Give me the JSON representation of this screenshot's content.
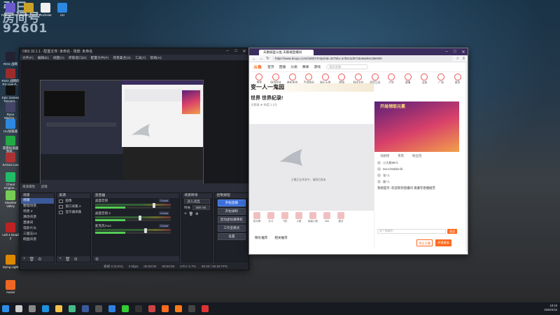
{
  "desktop": {
    "wallpaper_text": "引日\n房间号\n92601",
    "icons": [
      {
        "label": "Robust PEERSITE",
        "color": "#6a5acd"
      },
      {
        "label": "Tencent GTA V",
        "color": "#c9a227"
      },
      {
        "label": "Rockstar",
        "color": "#f0f0f0"
      },
      {
        "label": "UU",
        "color": "#2e88e0"
      },
      {
        "label": "RGS 战网",
        "color": "#223"
      },
      {
        "label": "ROG 战网的\nRX Live P...",
        "color": "#9c2c2c"
      },
      {
        "label": "Epic Games\nTencent...",
        "color": "#111"
      },
      {
        "label": "Ryou\nWarrior...",
        "color": "#446"
      },
      {
        "label": "UU加速器",
        "color": "#2e88e0"
      },
      {
        "label": "雷霆加速器\n游戏...",
        "color": "#2a4"
      },
      {
        "label": "SAN14 Leo",
        "color": "#a33"
      },
      {
        "label": "Cheat\nEngine...",
        "color": "#2b6"
      },
      {
        "label": "Stardew\nValley",
        "color": "#7c5"
      },
      {
        "label": "Left 4 Dead\n2",
        "color": "#b22"
      },
      {
        "label": "Dying Light",
        "color": "#d80"
      },
      {
        "label": "Assist",
        "color": "#e62"
      }
    ]
  },
  "obs": {
    "title": "OBS 32.1.1 - 配置文件: 未命名 - 场景: 未命名",
    "menu": [
      "文件(F)",
      "编辑(E)",
      "视图(V)",
      "停靠窗口(D)",
      "配置文件(P)",
      "场景集合(S)",
      "工具(T)",
      "帮助(H)"
    ],
    "tabs": [
      "来源属性",
      "滤镜"
    ],
    "scenes": {
      "header": "场景",
      "items": [
        "场景",
        "整理场景",
        "场景 2",
        "满场背景",
        "直播间",
        "电影片头",
        "三国志14",
        "韩国背景"
      ],
      "selected": 0
    },
    "sources": {
      "header": "来源",
      "items": [
        "图像",
        "窗口采集 2",
        "显示器采集"
      ]
    },
    "mixer": {
      "header": "混音器",
      "tracks": [
        {
          "name": "桌面音频",
          "db": "Global",
          "level": 0.82
        },
        {
          "name": "桌面音频 2",
          "db": "Global",
          "level": 0.62
        },
        {
          "name": "麦克风/Aux",
          "db": "Global",
          "level": 0.7
        }
      ]
    },
    "transitions": {
      "header": "场景转场",
      "type": "淡入淡出",
      "duration_label": "时长",
      "duration": "300 ms"
    },
    "controls": {
      "header": "控制按钮",
      "buttons": [
        "开始直播",
        "开始录制",
        "启动虚拟摄像机",
        "工作室模式",
        "设置"
      ]
    },
    "status": {
      "frames": "丢帧 0 (0.0%)",
      "bitrate": "0 kbps",
      "live_time": "00:00:00",
      "rec_time": "00:00:00",
      "cpu": "CPU: 0.7%",
      "fps": "60.00 / 60.00 FPS"
    },
    "preview_hint": "正在加载..."
  },
  "browser": {
    "tab_title": "天鹅城里斗鱼 天鹅城直播间",
    "url": "https://www.douyu.com/328074?dyshid=3275b1-a7b0c2d07c8e8a094c38e000",
    "site": {
      "logo": "斗鱼",
      "nav": [
        "首页",
        "直播",
        "分类",
        "赛事",
        "游戏"
      ],
      "search_placeholder": "搜索直播",
      "categories": [
        "推荐",
        "网游竞技",
        "单机热游",
        "手游休闲",
        "娱乐天地",
        "颜值",
        "科技文化",
        "语音互动",
        "户外",
        "赛事",
        "全部",
        "广场",
        "更多"
      ]
    },
    "room": {
      "banner": "变一人一鬼园",
      "title": "世界 世界纪录!",
      "subtitle": "天鹅城 ★ 热度 1.2万",
      "player_text": "主播正在休息中，请稍后再来"
    },
    "gifts": [
      "荧光棒",
      "办卡",
      "飞机",
      "火箭",
      "超级火箭",
      "666",
      "魔法"
    ],
    "below_gifts": [
      "精彩推荐",
      "相关推荐"
    ],
    "side": {
      "ad_title": "开局领取元素",
      "tabs": [
        "贡献榜",
        "贵宾",
        "粉丝团"
      ],
      "ranks": [
        "小天鹅8871",
        "Dunc/Wabkinfd",
        "张*人",
        "路*人"
      ],
      "chat": "系统提示: 欢迎来到直播间 请遵守直播规范",
      "send_placeholder": "发个弹幕吧~",
      "send_label": "发送"
    },
    "buttons": {
      "follow": "关注主播",
      "subscribe": "开通贵族"
    }
  },
  "taskbar": {
    "time": "18:19",
    "date": "2026/4/15",
    "icons": [
      "start",
      "search",
      "task-view",
      "edge",
      "explorer",
      "chrome",
      "steam",
      "obs",
      "qq",
      "wechat",
      "epic",
      "davinci",
      "douyu",
      "firefox",
      "terminal",
      "netease"
    ]
  }
}
